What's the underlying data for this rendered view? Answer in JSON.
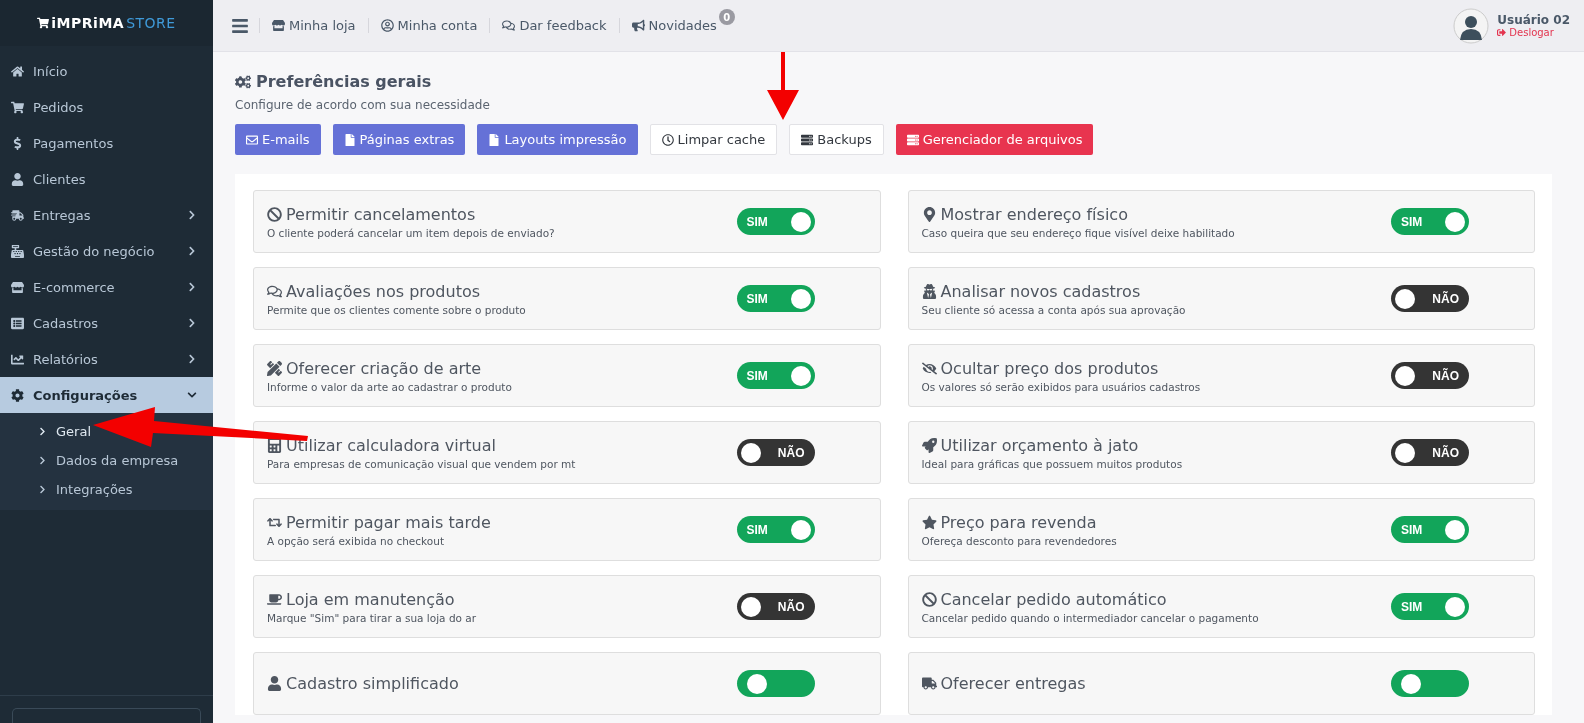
{
  "logo": {
    "part_1": "iMPRiMA",
    "part_2": "STORE"
  },
  "sidebar": {
    "items": [
      {
        "label": "Início",
        "kind": "link",
        "selected": false
      },
      {
        "label": "Pedidos",
        "kind": "link",
        "selected": false
      },
      {
        "label": "Pagamentos",
        "kind": "link",
        "selected": false
      },
      {
        "label": "Clientes",
        "kind": "link",
        "selected": false
      },
      {
        "label": "Entregas",
        "kind": "group",
        "selected": false
      },
      {
        "label": "Gestão do negócio",
        "kind": "group",
        "selected": false
      },
      {
        "label": "E-commerce",
        "kind": "group",
        "selected": false
      },
      {
        "label": "Cadastros",
        "kind": "group",
        "selected": false
      },
      {
        "label": "Relatórios",
        "kind": "group",
        "selected": false
      },
      {
        "label": "Configurações",
        "kind": "group",
        "expanded": true,
        "selected": true,
        "children": [
          {
            "label": "Geral",
            "selected": true
          },
          {
            "label": "Dados da empresa",
            "selected": false
          },
          {
            "label": "Integrações",
            "selected": false
          }
        ]
      }
    ]
  },
  "topbar": {
    "links": [
      "Minha loja",
      "Minha conta",
      "Dar feedback",
      "Novidades"
    ],
    "badge": "0",
    "user": {
      "name": "Usuário 02",
      "logout": "Deslogar"
    }
  },
  "page": {
    "title": "Preferências gerais",
    "subtitle": "Configure de acordo com sua necessidade",
    "buttons": [
      {
        "label": "E-mails",
        "kind": "primary"
      },
      {
        "label": "Páginas extras",
        "kind": "primary"
      },
      {
        "label": "Layouts impressão",
        "kind": "primary"
      },
      {
        "label": "Limpar cache",
        "kind": "plain"
      },
      {
        "label": "Backups",
        "kind": "plain"
      },
      {
        "label": "Gerenciador de arquivos",
        "kind": "danger"
      }
    ]
  },
  "settings": [
    {
      "title": "Permitir cancelamentos",
      "description": "O cliente poderá cancelar um item depois de enviado?",
      "on": true,
      "toggle": "SIM"
    },
    {
      "title": "Mostrar endereço físico",
      "description": "Caso queira que seu endereço fique visível deixe habilitado",
      "on": true,
      "toggle": "SIM"
    },
    {
      "title": "Avaliações nos produtos",
      "description": "Permite que os clientes comente sobre o produto",
      "on": true,
      "toggle": "SIM"
    },
    {
      "title": "Analisar novos cadastros",
      "description": "Seu cliente só acessa a conta após sua aprovação",
      "on": false,
      "toggle": "NÃO"
    },
    {
      "title": "Oferecer criação de arte",
      "description": "Informe o valor da arte ao cadastrar o produto",
      "on": true,
      "toggle": "SIM"
    },
    {
      "title": "Ocultar preço dos produtos",
      "description": "Os valores só serão exibidos para usuários cadastros",
      "on": false,
      "toggle": "NÃO"
    },
    {
      "title": "Utilizar calculadora virtual",
      "description": "Para empresas de comunicação visual que vendem por mt",
      "on": false,
      "toggle": "NÃO"
    },
    {
      "title": "Utilizar orçamento à jato",
      "description": "Ideal para gráficas que possuem muitos produtos",
      "on": false,
      "toggle": "NÃO"
    },
    {
      "title": "Permitir pagar mais tarde",
      "description": "A opção será exibida no checkout",
      "on": true,
      "toggle": "SIM"
    },
    {
      "title": "Preço para revenda",
      "description": "Ofereça desconto para revendedores",
      "on": true,
      "toggle": "SIM"
    },
    {
      "title": "Loja em manutenção",
      "description": "Marque \"Sim\" para tirar a sua loja do ar",
      "on": false,
      "toggle": "NÃO"
    },
    {
      "title": "Cancelar pedido automático",
      "description": "Cancelar pedido quando o intermediador cancelar o pagamento",
      "on": true,
      "toggle": "SIM"
    },
    {
      "title": "Cadastro simplificado",
      "on": true
    },
    {
      "title": "Oferecer entregas",
      "on": true
    }
  ]
}
